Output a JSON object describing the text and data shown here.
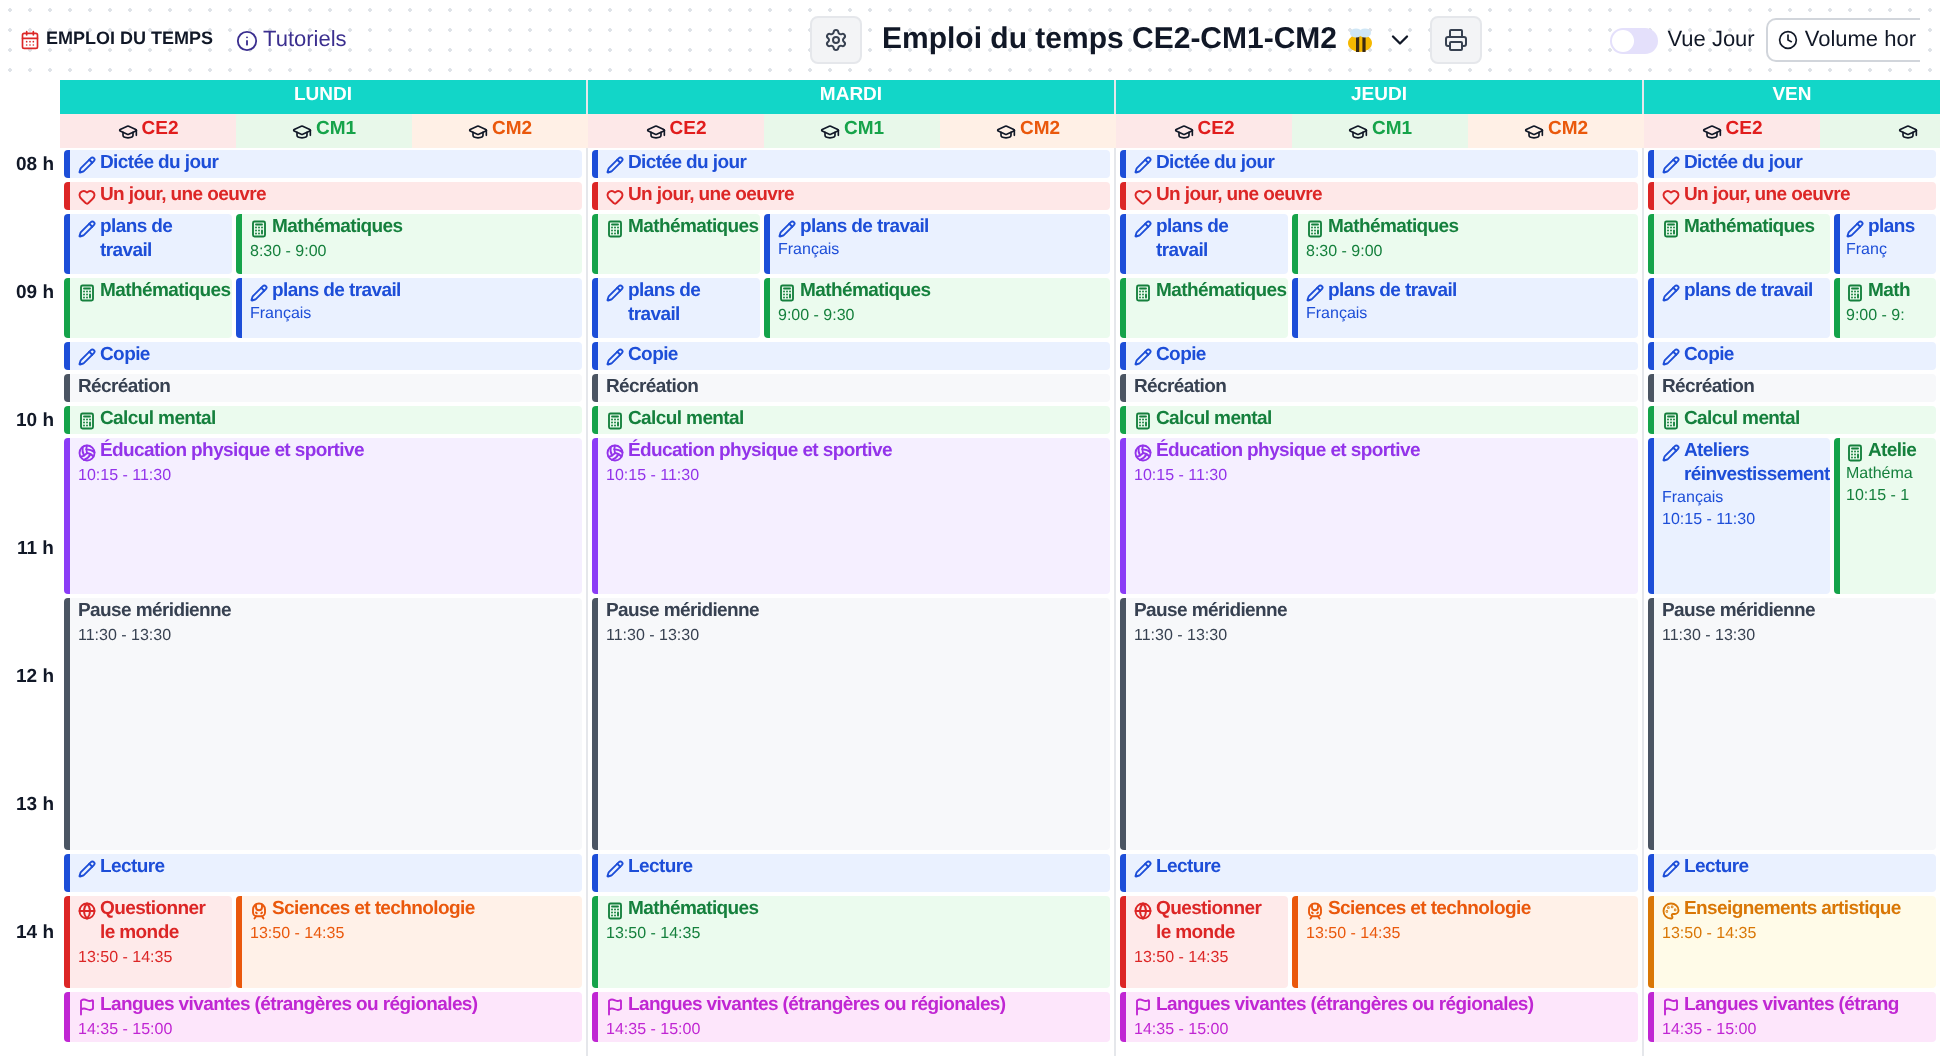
{
  "app": {
    "name": "EMPLOI DU TEMPS",
    "tutorials_link": "Tutoriels"
  },
  "toolbar": {
    "title": "Emploi du temps CE2-CM1-CM2",
    "view_toggle": {
      "label": "Vue Jour",
      "on": false
    },
    "volume_button": "Volume hor"
  },
  "hours": [
    "08 h",
    "09 h",
    "10 h",
    "11 h",
    "12 h",
    "13 h",
    "14 h"
  ],
  "days": [
    {
      "name": "LUNDI",
      "classes": [
        {
          "kind": "ce2",
          "label": "CE2"
        },
        {
          "kind": "cm1",
          "label": "CM1"
        },
        {
          "kind": "cm2",
          "label": "CM2"
        }
      ],
      "slots": [
        {
          "events": [
            {
              "kind": "francais",
              "title": "Dictée du jour"
            }
          ]
        },
        {
          "events": [
            {
              "kind": "art",
              "title": "Un jour, une oeuvre"
            }
          ]
        },
        {
          "events": [
            {
              "kind": "francais",
              "title": "plans de travail"
            },
            {
              "kind": "math",
              "title": "Mathématiques",
              "time": "8:30 - 9:00"
            }
          ]
        },
        {
          "events": [
            {
              "kind": "math",
              "title": "Mathématiques"
            },
            {
              "kind": "francais",
              "title": "plans de travail",
              "subtitle": "Français"
            }
          ]
        },
        {
          "events": [
            {
              "kind": "francais",
              "title": "Copie"
            }
          ]
        },
        {
          "events": [
            {
              "kind": "pause",
              "title": "Récréation"
            }
          ]
        },
        {
          "events": [
            {
              "kind": "math",
              "title": "Calcul mental"
            }
          ]
        },
        {
          "events": [
            {
              "kind": "eps",
              "title": "Éducation physique et sportive",
              "time": "10:15 - 11:30"
            }
          ]
        },
        {
          "events": [
            {
              "kind": "pause",
              "title": "Pause méridienne",
              "time": "11:30 - 13:30"
            }
          ]
        },
        {
          "events": [
            {
              "kind": "francais",
              "title": "Lecture"
            }
          ]
        },
        {
          "events": [
            {
              "kind": "monde",
              "title": "Questionner le monde",
              "time": "13:50 - 14:35"
            },
            {
              "kind": "sciences",
              "title": "Sciences et technologie",
              "time": "13:50 - 14:35"
            }
          ]
        },
        {
          "events": [
            {
              "kind": "langues",
              "title": "Langues vivantes (étrangères ou régionales)",
              "time": "14:35 - 15:00"
            }
          ]
        }
      ]
    },
    {
      "name": "MARDI",
      "classes": [
        {
          "kind": "ce2",
          "label": "CE2"
        },
        {
          "kind": "cm1",
          "label": "CM1"
        },
        {
          "kind": "cm2",
          "label": "CM2"
        }
      ],
      "slots": [
        {
          "events": [
            {
              "kind": "francais",
              "title": "Dictée du jour"
            }
          ]
        },
        {
          "events": [
            {
              "kind": "art",
              "title": "Un jour, une oeuvre"
            }
          ]
        },
        {
          "events": [
            {
              "kind": "math",
              "title": "Mathématiques"
            },
            {
              "kind": "francais",
              "title": "plans de travail",
              "subtitle": "Français"
            }
          ]
        },
        {
          "events": [
            {
              "kind": "francais",
              "title": "plans de travail"
            },
            {
              "kind": "math",
              "title": "Mathématiques",
              "time": "9:00 - 9:30"
            }
          ]
        },
        {
          "events": [
            {
              "kind": "francais",
              "title": "Copie"
            }
          ]
        },
        {
          "events": [
            {
              "kind": "pause",
              "title": "Récréation"
            }
          ]
        },
        {
          "events": [
            {
              "kind": "math",
              "title": "Calcul mental"
            }
          ]
        },
        {
          "events": [
            {
              "kind": "eps",
              "title": "Éducation physique et sportive",
              "time": "10:15 - 11:30"
            }
          ]
        },
        {
          "events": [
            {
              "kind": "pause",
              "title": "Pause méridienne",
              "time": "11:30 - 13:30"
            }
          ]
        },
        {
          "events": [
            {
              "kind": "francais",
              "title": "Lecture"
            }
          ]
        },
        {
          "events": [
            {
              "kind": "math",
              "title": "Mathématiques",
              "time": "13:50 - 14:35"
            }
          ]
        },
        {
          "events": [
            {
              "kind": "langues",
              "title": "Langues vivantes (étrangères ou régionales)",
              "time": "14:35 - 15:00"
            }
          ]
        }
      ]
    },
    {
      "name": "JEUDI",
      "classes": [
        {
          "kind": "ce2",
          "label": "CE2"
        },
        {
          "kind": "cm1",
          "label": "CM1"
        },
        {
          "kind": "cm2",
          "label": "CM2"
        }
      ],
      "slots": [
        {
          "events": [
            {
              "kind": "francais",
              "title": "Dictée du jour"
            }
          ]
        },
        {
          "events": [
            {
              "kind": "art",
              "title": "Un jour, une oeuvre"
            }
          ]
        },
        {
          "events": [
            {
              "kind": "francais",
              "title": "plans de travail"
            },
            {
              "kind": "math",
              "title": "Mathématiques",
              "time": "8:30 - 9:00"
            }
          ]
        },
        {
          "events": [
            {
              "kind": "math",
              "title": "Mathématiques"
            },
            {
              "kind": "francais",
              "title": "plans de travail",
              "subtitle": "Français"
            }
          ]
        },
        {
          "events": [
            {
              "kind": "francais",
              "title": "Copie"
            }
          ]
        },
        {
          "events": [
            {
              "kind": "pause",
              "title": "Récréation"
            }
          ]
        },
        {
          "events": [
            {
              "kind": "math",
              "title": "Calcul mental"
            }
          ]
        },
        {
          "events": [
            {
              "kind": "eps",
              "title": "Éducation physique et sportive",
              "time": "10:15 - 11:30"
            }
          ]
        },
        {
          "events": [
            {
              "kind": "pause",
              "title": "Pause méridienne",
              "time": "11:30 - 13:30"
            }
          ]
        },
        {
          "events": [
            {
              "kind": "francais",
              "title": "Lecture"
            }
          ]
        },
        {
          "events": [
            {
              "kind": "monde",
              "title": "Questionner le monde",
              "time": "13:50 - 14:35"
            },
            {
              "kind": "sciences",
              "title": "Sciences et technologie",
              "time": "13:50 - 14:35"
            }
          ]
        },
        {
          "events": [
            {
              "kind": "langues",
              "title": "Langues vivantes (étrangères ou régionales)",
              "time": "14:35 - 15:00"
            }
          ]
        }
      ]
    },
    {
      "name": "VEN",
      "classes": [
        {
          "kind": "ce2",
          "label": "CE2"
        },
        {
          "kind": "cm1"
        }
      ],
      "slots": [
        {
          "events": [
            {
              "kind": "francais",
              "title": "Dictée du jour"
            }
          ]
        },
        {
          "events": [
            {
              "kind": "art",
              "title": "Un jour, une oeuvre"
            }
          ]
        },
        {
          "events": [
            {
              "kind": "math",
              "title": "Mathématiques"
            },
            {
              "kind": "francais",
              "title": "plans",
              "subtitle": "Franç"
            }
          ]
        },
        {
          "events": [
            {
              "kind": "francais",
              "title": "plans de travail"
            },
            {
              "kind": "math",
              "title": "Math",
              "time": "9:00 - 9:"
            }
          ]
        },
        {
          "events": [
            {
              "kind": "francais",
              "title": "Copie"
            }
          ]
        },
        {
          "events": [
            {
              "kind": "pause",
              "title": "Récréation"
            }
          ]
        },
        {
          "events": [
            {
              "kind": "math",
              "title": "Calcul mental"
            }
          ]
        },
        {
          "events": [
            {
              "kind": "francais",
              "title": "Ateliers réinvestissement",
              "subtitle": "Français",
              "time": "10:15 - 11:30"
            },
            {
              "kind": "math",
              "title": "Atelie",
              "subtitle": "Mathéma",
              "time": "10:15 - 1"
            }
          ]
        },
        {
          "events": [
            {
              "kind": "pause",
              "title": "Pause méridienne",
              "time": "11:30 - 13:30"
            }
          ]
        },
        {
          "events": [
            {
              "kind": "francais",
              "title": "Lecture"
            }
          ]
        },
        {
          "events": [
            {
              "kind": "arts",
              "title": "Enseignements artistique",
              "time": "13:50 - 14:35"
            }
          ]
        },
        {
          "events": [
            {
              "kind": "langues",
              "title": "Langues vivantes (étrang",
              "time": "14:35 - 15:00"
            }
          ]
        }
      ]
    }
  ]
}
